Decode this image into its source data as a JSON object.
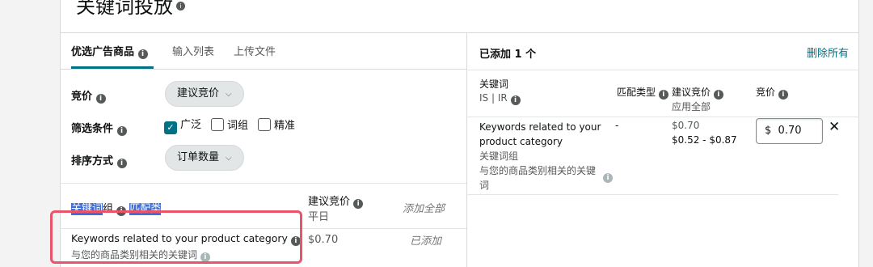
{
  "page": {
    "title": "关键词投放"
  },
  "left": {
    "tabs": [
      {
        "label": "优选广告商品"
      },
      {
        "label": "输入列表"
      },
      {
        "label": "上传文件"
      }
    ],
    "bid": {
      "label": "竞价",
      "value": "建议竞价"
    },
    "filter": {
      "label": "筛选条件",
      "options": [
        {
          "label": "广泛",
          "checked": true
        },
        {
          "label": "词组",
          "checked": false
        },
        {
          "label": "精准",
          "checked": false
        }
      ]
    },
    "sort": {
      "label": "排序方式",
      "value": "订单数量"
    },
    "table": {
      "col_keyword": "关键词",
      "col_keyword_rest": "组",
      "col_match": "匹配类",
      "col_bid": "建议竞价",
      "col_bid_sub": "平日",
      "add_all": "添加全部",
      "rows": [
        {
          "title": "Keywords related to your product category",
          "subtitle": "与您的商品类别相关的关键词",
          "bid": "$0.70",
          "action": "已添加"
        }
      ]
    }
  },
  "right": {
    "added_title": "已添加 1 个",
    "remove_all": "删除所有",
    "table": {
      "col_keyword": "关键词",
      "col_keyword_sub": "IS | IR",
      "col_match": "匹配类型",
      "col_suggested": "建议竞价",
      "col_suggested_sub": "应用全部",
      "col_bid": "竞价",
      "rows": [
        {
          "line1": "Keywords related to your",
          "line2": "product category",
          "line3": "关键词组",
          "line4": "与您的商品类别相关的关键",
          "line5": "词",
          "match": "-",
          "suggested": "$0.70",
          "range": "$0.52 - $0.87",
          "currency": "$",
          "bid_value": "0.70"
        }
      ]
    }
  }
}
